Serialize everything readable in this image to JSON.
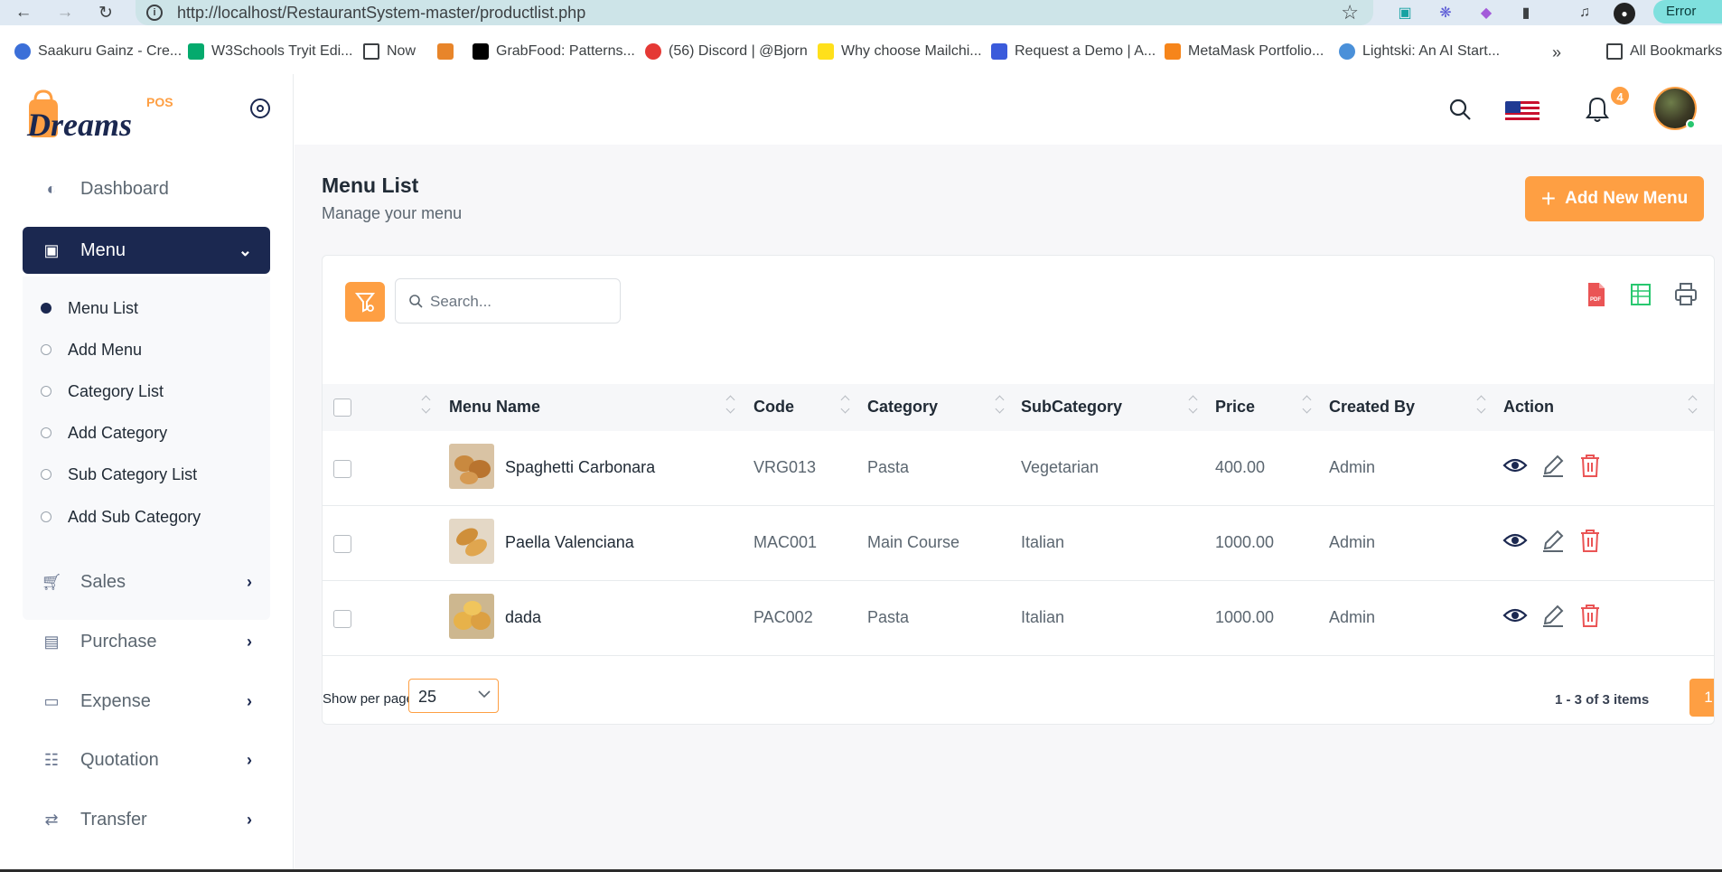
{
  "browser": {
    "url": "http://localhost/RestaurantSystem-master/productlist.php",
    "error_label": "Error",
    "bookmarks": [
      {
        "label": "Saakuru Gainz - Cre...",
        "icon": "saakuru-icon",
        "color": "#3b6fd8"
      },
      {
        "label": "W3Schools Tryit Edi...",
        "icon": "w3schools-icon",
        "color": "#04aa6d"
      },
      {
        "label": "Now",
        "icon": "folder-icon",
        "color": "#3c4043"
      },
      {
        "label": "",
        "icon": "figure-icon",
        "color": "#e8852a"
      },
      {
        "label": "GrabFood: Patterns...",
        "icon": "medium-icon",
        "color": "#000000"
      },
      {
        "label": "(56) Discord | @Bjorn",
        "icon": "discord-icon",
        "color": "#e53935"
      },
      {
        "label": "Why choose Mailchi...",
        "icon": "mailchimp-icon",
        "color": "#ffe01b"
      },
      {
        "label": "Request a Demo | A...",
        "icon": "demo-icon",
        "color": "#3b5bdb"
      },
      {
        "label": "MetaMask Portfolio...",
        "icon": "metamask-icon",
        "color": "#f6851b"
      },
      {
        "label": "Lightski: An AI Start...",
        "icon": "lightski-icon",
        "color": "#4a90d9"
      }
    ],
    "all_bookmarks": "All Bookmarks"
  },
  "sidebar": {
    "logo_text": "Dreams",
    "logo_badge": "POS",
    "items": [
      {
        "label": "Dashboard",
        "icon": "dashboard-icon"
      },
      {
        "label": "Menu",
        "icon": "box-icon",
        "active": true
      },
      {
        "label": "Sales",
        "icon": "cart-icon"
      },
      {
        "label": "Purchase",
        "icon": "purchase-icon"
      },
      {
        "label": "Expense",
        "icon": "wallet-icon"
      },
      {
        "label": "Quotation",
        "icon": "quotation-icon"
      },
      {
        "label": "Transfer",
        "icon": "transfer-icon"
      }
    ],
    "submenu": [
      {
        "label": "Menu List",
        "active": true
      },
      {
        "label": "Add Menu"
      },
      {
        "label": "Category List"
      },
      {
        "label": "Add Category"
      },
      {
        "label": "Sub Category List"
      },
      {
        "label": "Add Sub Category"
      }
    ]
  },
  "header": {
    "notification_count": "4"
  },
  "page": {
    "title": "Menu List",
    "subtitle": "Manage your menu",
    "add_button": "Add New Menu",
    "search_placeholder": "Search..."
  },
  "table": {
    "columns": [
      "Menu Name",
      "Code",
      "Category",
      "SubCategory",
      "Price",
      "Created By",
      "Action"
    ],
    "rows": [
      {
        "name": "Spaghetti Carbonara",
        "code": "VRG013",
        "category": "Pasta",
        "subcategory": "Vegetarian",
        "price": "400.00",
        "created_by": "Admin"
      },
      {
        "name": "Paella Valenciana",
        "code": "MAC001",
        "category": "Main Course",
        "subcategory": "Italian",
        "price": "1000.00",
        "created_by": "Admin"
      },
      {
        "name": "dada",
        "code": "PAC002",
        "category": "Pasta",
        "subcategory": "Italian",
        "price": "1000.00",
        "created_by": "Admin"
      }
    ]
  },
  "pagination": {
    "per_page_label": "Show per page :",
    "per_page_value": "25",
    "items_info": "1 - 3 of 3 items",
    "current_page": "1"
  },
  "colors": {
    "accent": "#fe9f43",
    "navy": "#1b2850",
    "danger": "#ea5455",
    "success": "#28c76f"
  }
}
